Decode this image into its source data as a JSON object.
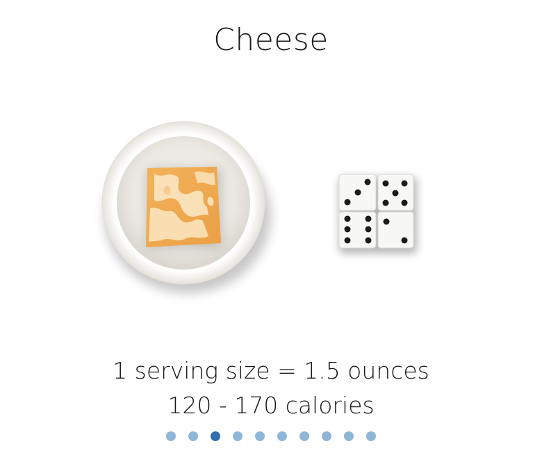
{
  "title": "Cheese",
  "caption": {
    "serving": "1 serving size = 1.5 ounces",
    "calories": "120 - 170 calories"
  },
  "illustration": {
    "subject": "cheese-cube-on-plate",
    "comparison": "four-dice"
  },
  "pager": {
    "total": 10,
    "current_index": 2
  },
  "colors": {
    "dot_inactive": "#8fb6d6",
    "dot_active": "#2f6fad"
  }
}
